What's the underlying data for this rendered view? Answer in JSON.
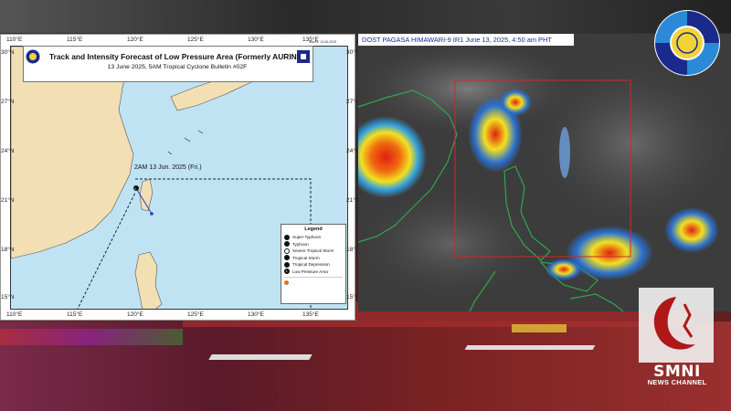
{
  "forecast_map": {
    "title": "Track and Intensity Forecast of Low Pressure Area (Formerly AURING)",
    "subtitle": "13 June 2025, 5AM Tropical Cyclone Bulletin #02F",
    "top_right_note": "Issued: 13-06-2025",
    "longitudes": [
      "110°E",
      "115°E",
      "120°E",
      "125°E",
      "130°E",
      "135°E"
    ],
    "latitudes": [
      "30°N",
      "27°N",
      "24°N",
      "21°N",
      "18°N",
      "15°N"
    ],
    "lpa_label": "2AM 13 Jun. 2025 (Fri.)",
    "legend": {
      "title": "Legend",
      "items": [
        "Super Typhoon",
        "Typhoon",
        "Severe Tropical Storm",
        "Tropical Storm",
        "Tropical Depression",
        "Low Pressure Area"
      ]
    }
  },
  "satellite": {
    "title": "DOST PAGASA HIMAWARI-9 IR1 June 13, 2025, 4:50 am PHT"
  },
  "branding": {
    "channel": "SMNI",
    "channel_sub": "NEWS CHANNEL"
  },
  "colors": {
    "land": "#f3dfb4",
    "sea": "#bfe3f3",
    "storm_red": "#e02010",
    "storm_yellow": "#f2e020",
    "coast_green": "#2ea84a"
  }
}
